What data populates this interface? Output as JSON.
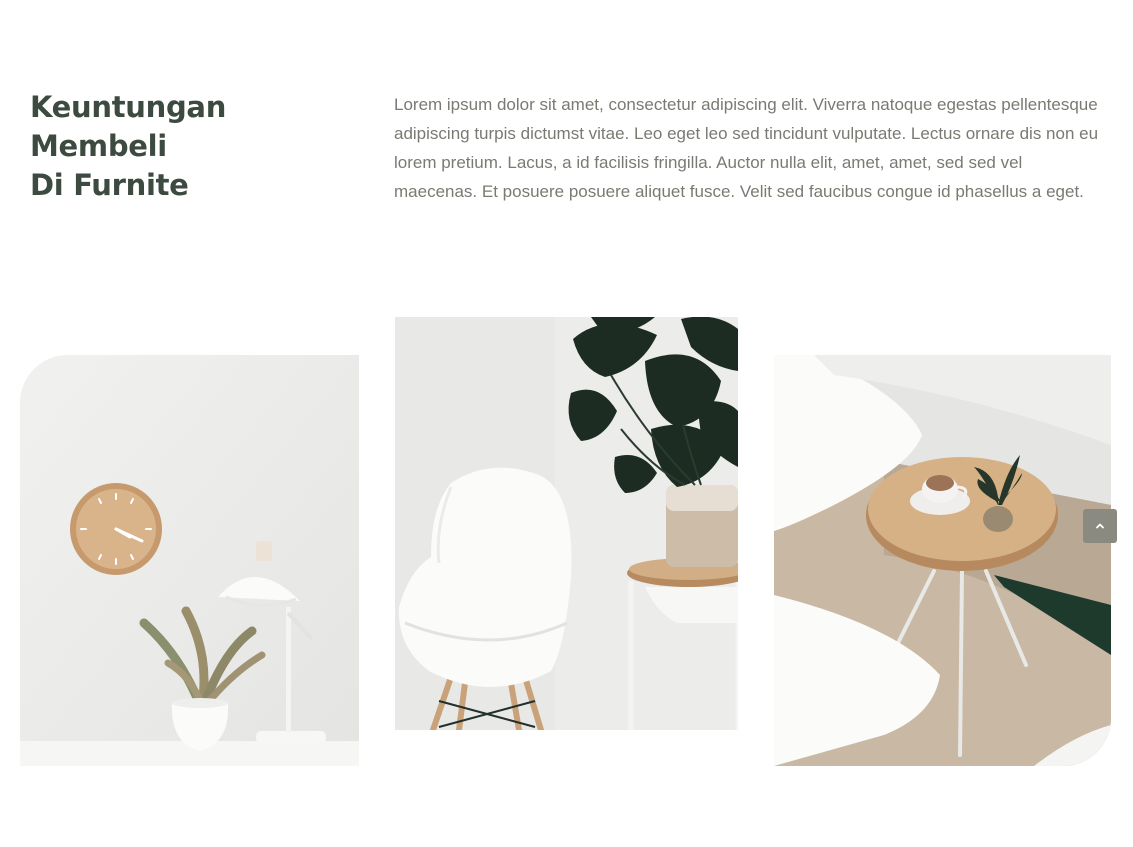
{
  "section": {
    "title_line1": "Keuntungan Membeli",
    "title_line2": "Di Furnite",
    "description": "Lorem ipsum dolor sit amet, consectetur adipiscing elit. Viverra natoque egestas pellentesque adipiscing turpis dictumst vitae. Leo eget leo sed tincidunt vulputate. Lectus ornare dis non eu lorem pretium. Lacus, a id facilisis fringilla. Auctor nulla elit, amet, amet, sed sed vel maecenas. Et posuere posuere aliquet fusce. Velit sed faucibus congue id phasellus a eget."
  },
  "gallery": [
    {
      "name": "photo-clock-lamp-plant"
    },
    {
      "name": "photo-white-chair-monstera"
    },
    {
      "name": "photo-round-table-coffee"
    }
  ],
  "scroll_top": {
    "icon": "chevron-up-icon"
  },
  "colors": {
    "heading": "#3c4a40",
    "body_text": "#7a7a72",
    "scroll_button": "#8a8a80",
    "scroll_icon": "#ffffff"
  }
}
